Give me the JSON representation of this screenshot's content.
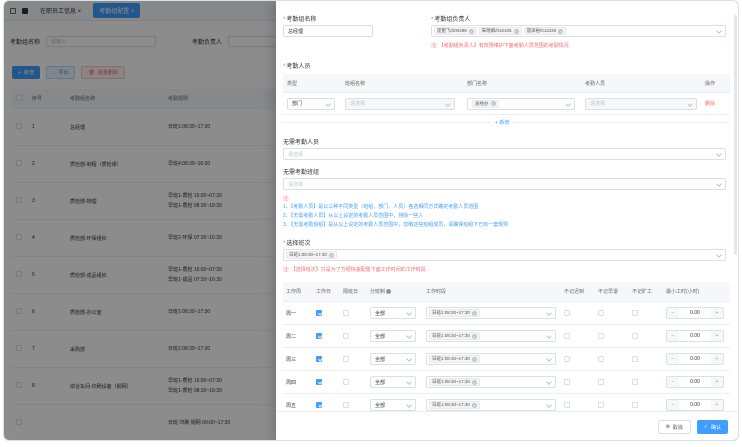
{
  "topbar": {
    "tabs": [
      "在职员工信息",
      "考勤组配置"
    ]
  },
  "search": {
    "label1": "考勤组名称",
    "placeholder1": "请输入",
    "label2": "考勤负责人"
  },
  "toolbar": {
    "add": "新增",
    "export": "导出",
    "delete": "批量删除"
  },
  "table": {
    "headers": [
      "序号",
      "考勤组名称",
      "考勤规则"
    ],
    "rows": [
      {
        "no": "1",
        "name": "总经理",
        "rule": [
          "日班1:08:30~17:30"
        ]
      },
      {
        "no": "2",
        "name": "质检部-制程（质检课）",
        "rule": [
          "早班4:08:30~16:30"
        ]
      },
      {
        "no": "3",
        "name": "质检部-物理",
        "rule": [
          "早班1-质检 16:00~07:30",
          "早班1-质检 08:30~18:30"
        ]
      },
      {
        "no": "4",
        "name": "质检部-环保组织",
        "rule": [
          "早班2-环保 07:30~16:30"
        ]
      },
      {
        "no": "5",
        "name": "质检部-成品组织",
        "rule": [
          "早班1-质检 16:00~07:30",
          "早班1-成品 07:30~16:30"
        ]
      },
      {
        "no": "6",
        "name": "质检部-办公室",
        "rule": [
          "日班1:08:30~17:30"
        ]
      },
      {
        "no": "7",
        "name": "采购部",
        "rule": [
          "日班1:08:30~17:30"
        ]
      },
      {
        "no": "8",
        "name": "综合车间-印刷设备（钢网）",
        "rule": [
          "早班1-质检 16:00~07:30",
          "早班1-质检 08:30~18:30"
        ]
      },
      {
        "no": "",
        "name": "",
        "rule": [
          "日班 印刷 钢网 09:00~17:30"
        ]
      }
    ]
  },
  "drawer": {
    "name_label": "考勤组名称",
    "name_value": "总经理",
    "leader_label": "考勤组负责人",
    "leaders": [
      "庞肥飞/000498",
      "朱晓姆/016105",
      "聂泽裕/012320"
    ],
    "leader_note": "【考勤组负责人】有权限维护下面考勤人员范围的考勤情况",
    "people_title": "考勤人员",
    "people_headers": [
      "类型",
      "班组名称",
      "部门名称",
      "考勤人员",
      "操作"
    ],
    "people_row": {
      "type": "部门",
      "group": "请选择",
      "dept": "总经办",
      "person": "请选择",
      "op": "删除"
    },
    "add_link": "新增",
    "no_people_label": "无需考勤人员",
    "no_people_ph": "请选择",
    "no_group_label": "无需考勤班组",
    "no_group_ph": "请选择",
    "note_title": "注:",
    "notes": [
      "1、【考勤人员】是以三种不同类型（班组、部门、人员）各选相同方式确定考勤人员范围",
      "2、【无需考勤人员】从以上设定的考勤人员范围中，排除一些人",
      "3、【无需考勤班组】是从以上设定的考勤人员范围中，忽略这些班组成员，请确保班组下已有一套规则"
    ],
    "shift_label": "选择班次",
    "shift_tag": "日班1:08:30~17:30",
    "shift_note": "【选择班次】只是为了方便快速配置下面工作时间的工作时段",
    "week_headers": [
      "工作周",
      "工作日",
      "隔班日",
      "分班制",
      "工作时段",
      "不记迟到",
      "不记早退",
      "不记旷工",
      "最小工时(小时)"
    ],
    "week_rows": [
      {
        "day": "周一",
        "work": true,
        "mode": "全部",
        "shift": "日班1:08:30~17:30",
        "hours": "0.00"
      },
      {
        "day": "周二",
        "work": true,
        "mode": "全部",
        "shift": "日班1:08:30~17:30",
        "hours": "0.00"
      },
      {
        "day": "周三",
        "work": true,
        "mode": "全部",
        "shift": "日班1:08:30~17:30",
        "hours": "0.00"
      },
      {
        "day": "周四",
        "work": true,
        "mode": "全部",
        "shift": "日班1:08:30~17:30",
        "hours": "0.00"
      },
      {
        "day": "周五",
        "work": true,
        "mode": "全部",
        "shift": "日班1:08:30~17:30",
        "hours": "0.00"
      }
    ],
    "cancel": "取消",
    "ok": "确认"
  }
}
